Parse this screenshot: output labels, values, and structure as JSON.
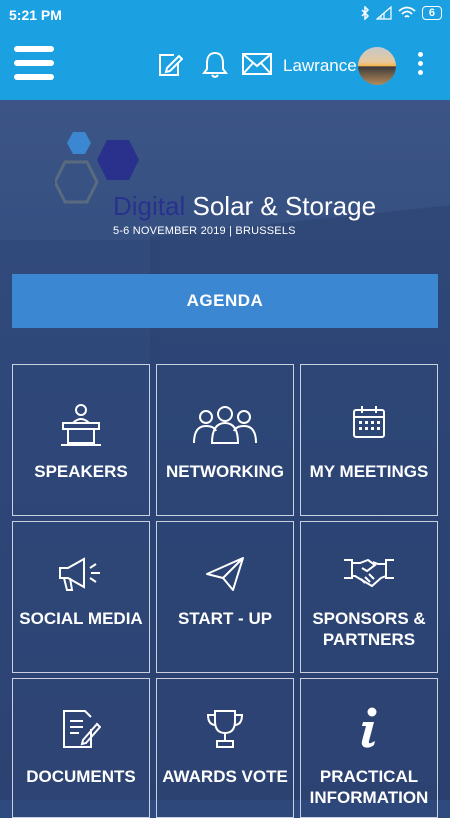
{
  "status_bar": {
    "time": "5:21 PM",
    "battery": "6"
  },
  "app_bar": {
    "username": "Lawrance"
  },
  "event": {
    "title_highlight": "Digital",
    "title_rest": "Solar & Storage",
    "subtitle": "5-6 NOVEMBER 2019 | BRUSSELS"
  },
  "agenda": {
    "label": "AGENDA"
  },
  "tiles": [
    {
      "label": "SPEAKERS",
      "icon": "podium-speaker-icon"
    },
    {
      "label": "NETWORKING",
      "icon": "people-group-icon"
    },
    {
      "label": "MY MEETINGS",
      "icon": "calendar-icon"
    },
    {
      "label": "SOCIAL MEDIA",
      "icon": "megaphone-icon"
    },
    {
      "label": "START - UP",
      "icon": "paper-plane-icon"
    },
    {
      "label": "SPONSORS & PARTNERS",
      "icon": "handshake-icon"
    },
    {
      "label": "DOCUMENTS",
      "icon": "document-pen-icon"
    },
    {
      "label": "AWARDS VOTE",
      "icon": "trophy-icon"
    },
    {
      "label": "PRACTICAL INFORMATION",
      "icon": "info-icon"
    }
  ],
  "colors": {
    "app_bar": "#1ba1e2",
    "agenda_button": "#3b87d1",
    "logo_dark": "#2a318d",
    "logo_light": "#3b87d1"
  }
}
